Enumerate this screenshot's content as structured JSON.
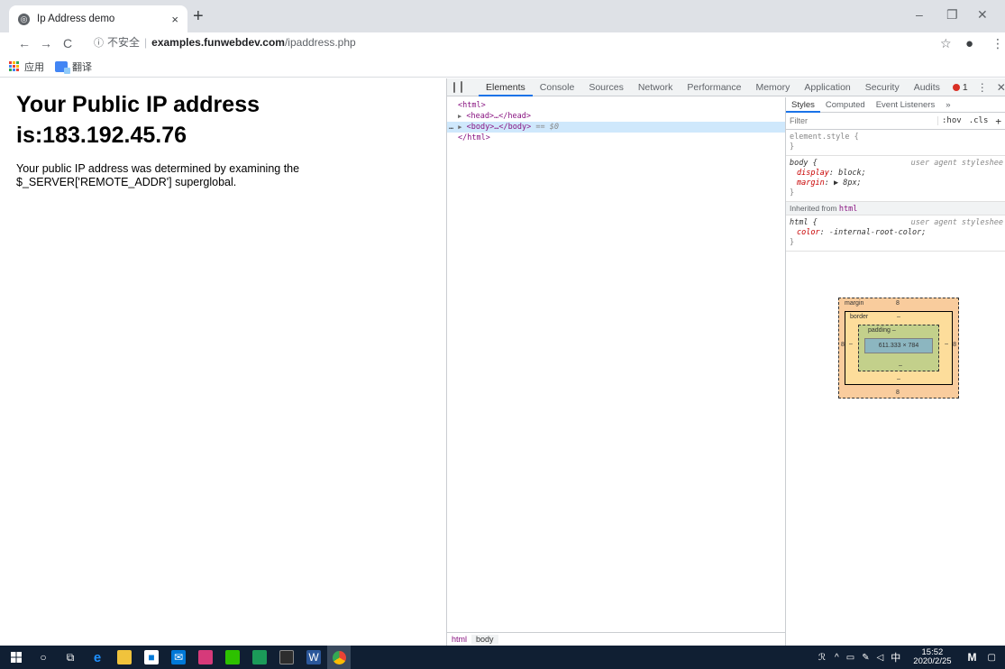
{
  "browser": {
    "tab_title": "Ip Address demo",
    "tab_close": "×",
    "new_tab": "+",
    "insecure_label": "不安全",
    "separator": "|",
    "url_host": "examples.funwebdev.com",
    "url_path": "/ipaddress.php",
    "bookmarks": [
      "应用",
      "翻译"
    ]
  },
  "page": {
    "heading": "Your Public IP address is:183.192.45.76",
    "paragraph": "Your public IP address was determined by examining the $_SERVER['REMOTE_ADDR'] superglobal."
  },
  "devtools": {
    "tabs": [
      "Elements",
      "Console",
      "Sources",
      "Network",
      "Performance",
      "Memory",
      "Application",
      "Security",
      "Audits"
    ],
    "error_count": "1",
    "dom": {
      "html_open": "<html>",
      "head": "<head>…</head>",
      "body": "<body>…</body>",
      "body_eq": "== $0",
      "html_close": "</html>",
      "ellipsis": "…"
    },
    "crumbs": [
      "html",
      "body"
    ],
    "styles_tabs": [
      "Styles",
      "Computed",
      "Event Listeners",
      "»"
    ],
    "filter_placeholder": "Filter",
    "hov": ":hov",
    "cls": ".cls",
    "plus": "+",
    "rules": {
      "element_style": "element.style {",
      "close_brace": "}",
      "body_selector": "body {",
      "body_src": "user agent styleshee",
      "display_prop": "display",
      "display_val": "block;",
      "margin_prop": "margin",
      "margin_val": "▶ 8px;",
      "inherited_label": "Inherited from",
      "inherited_tag": "html",
      "html_selector": "html {",
      "html_src": "user agent styleshee",
      "color_prop": "color",
      "color_val": "-internal-root-color;"
    },
    "box_model": {
      "margin_label": "margin",
      "margin_top": "8",
      "margin_bottom": "8",
      "margin_left": "8",
      "margin_right": "8",
      "border_label": "border",
      "border_dash": "–",
      "padding_label": "padding –",
      "content_size": "611.333 × 784"
    }
  },
  "taskbar": {
    "time": "15:52",
    "date": "2020/2/25",
    "ime": "中"
  }
}
